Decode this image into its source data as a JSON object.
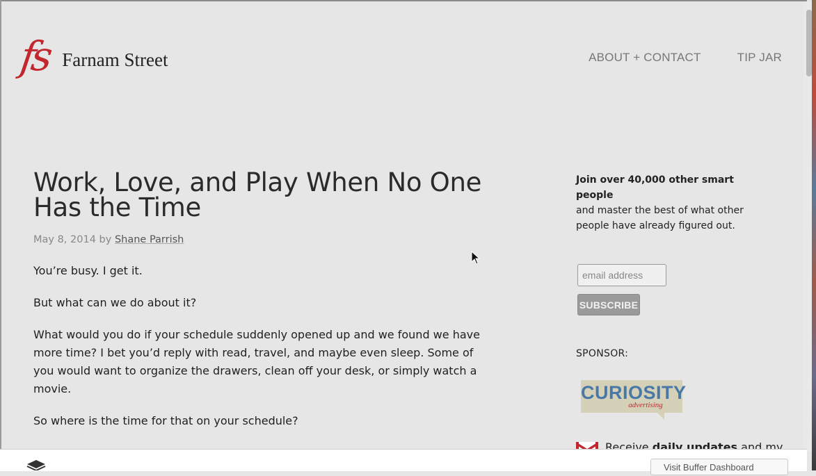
{
  "site": {
    "logo_mark": "fs",
    "logo_text": "Farnam Street"
  },
  "nav": {
    "items": [
      {
        "label": "ABOUT + CONTACT"
      },
      {
        "label": "TIP JAR"
      }
    ]
  },
  "article": {
    "title": "Work, Love, and Play When No One Has the Time",
    "date": "May 8, 2014",
    "by": "by",
    "author": "Shane Parrish",
    "paragraphs": [
      "You’re busy. I get it.",
      "But what can we do about it?",
      "What would you do if your schedule suddenly opened up and we found we have more time? I bet you’d reply with read, travel, and maybe even sleep. Some of you would want to organize the drawers, clean off your desk, or simply watch a movie.",
      "So where is the time for that on your schedule?"
    ]
  },
  "sidebar": {
    "join_bold": "Join over 40,000 other smart people",
    "join_rest": "and master the best of what other people have already figured out.",
    "email_placeholder": "email address",
    "subscribe_label": "SUBSCRIBE",
    "sponsor_label": "SPONSOR:",
    "sponsor_brand": "CURIOSITY",
    "sponsor_sub": "advertising",
    "daily_prefix": "Receive",
    "daily_bold": "daily updates",
    "daily_suffix": "and my"
  },
  "buffer": {
    "button_label": "Visit Buffer Dashboard"
  },
  "colors": {
    "brand_red": "#c1272d",
    "background": "#e6e6e6",
    "sponsor_blue": "#4a78a6"
  }
}
